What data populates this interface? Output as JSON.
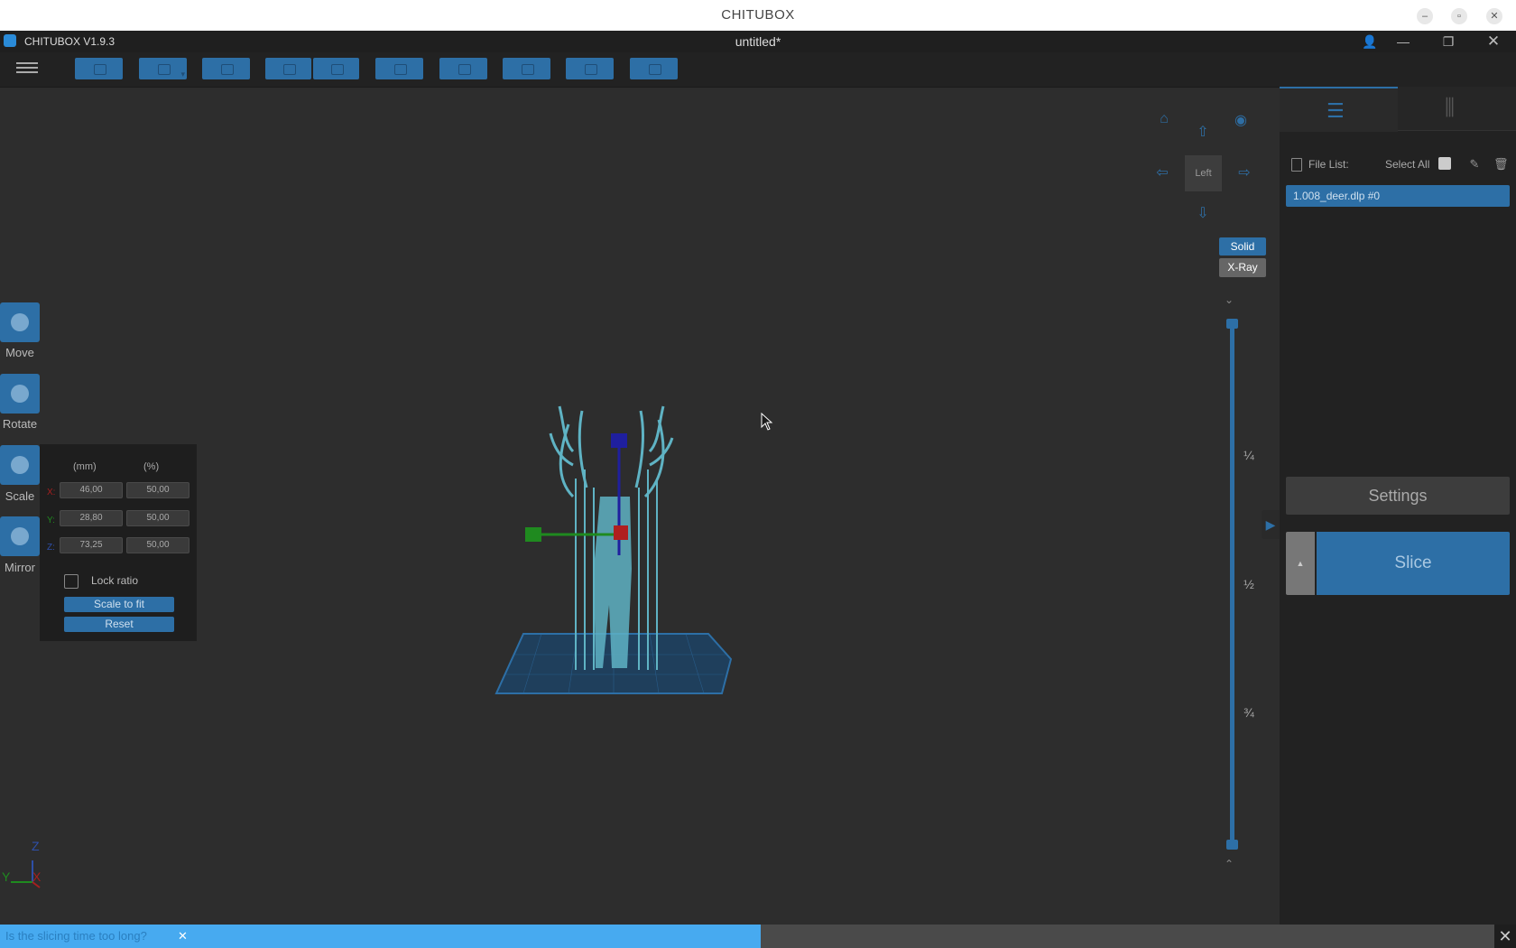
{
  "os_window": {
    "title": "CHITUBOX"
  },
  "app": {
    "name": "CHITUBOX V1.9.3",
    "document_title": "untitled*"
  },
  "viewport": {
    "view_cube_label": "Left",
    "render_modes": {
      "solid": "Solid",
      "xray": "X-Ray"
    },
    "layer_fractions": [
      "¼",
      "½",
      "¾"
    ],
    "axis_labels": {
      "z": "Z",
      "y": "Y",
      "x": "X"
    }
  },
  "left_tools": [
    {
      "label": "Move"
    },
    {
      "label": "Rotate"
    },
    {
      "label": "Scale"
    },
    {
      "label": "Mirror"
    }
  ],
  "scale_panel": {
    "headers": {
      "mm": "(mm)",
      "pct": "(%)"
    },
    "rows": [
      {
        "axis": "X:",
        "mm": "46,00",
        "pct": "50,00"
      },
      {
        "axis": "Y:",
        "mm": "28,80",
        "pct": "50,00"
      },
      {
        "axis": "Z:",
        "mm": "73,25",
        "pct": "50,00"
      }
    ],
    "lock_ratio_label": "Lock ratio",
    "scale_to_fit_label": "Scale to fit",
    "reset_label": "Reset"
  },
  "right_panel": {
    "file_list_label": "File List:",
    "select_all_label": "Select All",
    "files": [
      "1.008_deer.dlp #0"
    ],
    "settings_label": "Settings",
    "slice_label": "Slice"
  },
  "notification": {
    "text": "Is the slicing time too long?",
    "dismiss": "✕"
  },
  "colors": {
    "accent": "#2d6fa6",
    "background": "#2d2d2d",
    "model": "#5fb3c4",
    "notification": "#47aaf0"
  }
}
